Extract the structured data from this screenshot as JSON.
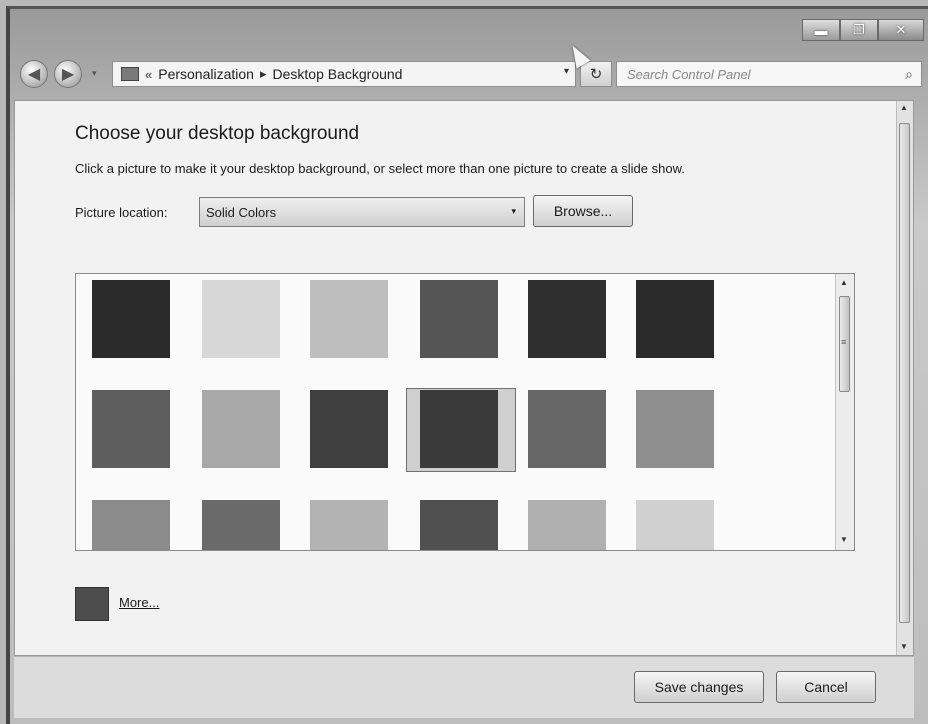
{
  "window": {
    "titlebar_buttons": {
      "minimize": "▬",
      "maximize": "❐",
      "close": "✕"
    }
  },
  "nav": {
    "back_icon": "◀",
    "forward_icon": "▶",
    "history_dropdown": "▾",
    "breadcrumb": {
      "overflow": "«",
      "items": [
        "Personalization",
        "Desktop Background"
      ],
      "separator": "▸"
    },
    "address_dropdown": "▾",
    "refresh_icon": "↻",
    "search_placeholder": "Search Control Panel",
    "search_icon": "⌕"
  },
  "page": {
    "title": "Choose your desktop background",
    "subtitle": "Click a picture to make it your desktop background, or select more than one picture to create a slide show.",
    "picture_location_label": "Picture location:",
    "picture_location_value": "Solid Colors",
    "select_caret": "▾",
    "browse_label": "Browse...",
    "swatches": [
      {
        "color": "#2b2b2b"
      },
      {
        "color": "#d7d7d7"
      },
      {
        "color": "#bebebe"
      },
      {
        "color": "#555555"
      },
      {
        "color": "#2f2f2f"
      },
      {
        "color": "#2a2a2a"
      },
      {
        "color": "#5e5e5e"
      },
      {
        "color": "#a8a8a8"
      },
      {
        "color": "#3f3f3f"
      },
      {
        "color": "#3a3a3a",
        "selected": true
      },
      {
        "color": "#666666"
      },
      {
        "color": "#8f8f8f"
      },
      {
        "color": "#8c8c8c"
      },
      {
        "color": "#6a6a6a"
      },
      {
        "color": "#b3b3b3"
      },
      {
        "color": "#505050"
      },
      {
        "color": "#b0b0b0"
      },
      {
        "color": "#d0d0d0"
      }
    ],
    "grid_scroll": {
      "up": "▲",
      "down": "▼",
      "grip": "≡"
    },
    "more_label": "More...",
    "more_swatch_color": "#4d4d4d"
  },
  "footer": {
    "save_label": "Save changes",
    "cancel_label": "Cancel"
  }
}
